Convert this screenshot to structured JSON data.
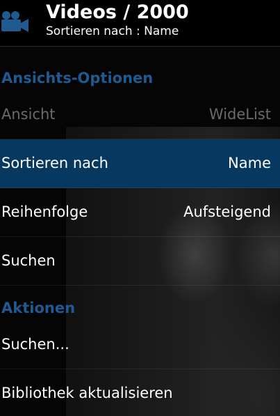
{
  "header": {
    "title": "Videos / 2000",
    "subtitle": "Sortieren nach : Name",
    "icon": "video-camera-icon"
  },
  "sections": {
    "view_options": {
      "title": "Ansichts-Optionen"
    },
    "actions": {
      "title": "Aktionen"
    }
  },
  "rows": {
    "view": {
      "label": "Ansicht",
      "value": "WideList",
      "enabled": false
    },
    "sort_by": {
      "label": "Sortieren nach",
      "value": "Name",
      "selected": true
    },
    "order": {
      "label": "Reihenfolge",
      "value": "Aufsteigend"
    },
    "search": {
      "label": "Suchen"
    },
    "search_action": {
      "label": "Suchen..."
    },
    "update_library": {
      "label": "Bibliothek aktualisieren"
    }
  },
  "colors": {
    "accent": "#1f5a91",
    "selected_background": "#07385f",
    "disabled_text": "#6a6a6a"
  }
}
